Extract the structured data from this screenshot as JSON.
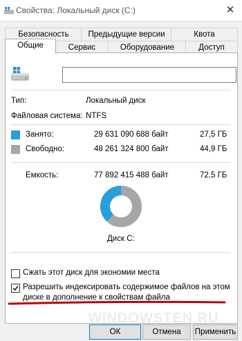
{
  "window": {
    "title": "Свойства: Локальный диск (C:)",
    "close_glyph": "✕"
  },
  "tabs_row1": [
    "Безопасность",
    "Предыдущие версии",
    "Квота"
  ],
  "tabs_row2": [
    "Общие",
    "Сервис",
    "Оборудование",
    "Доступ"
  ],
  "active_tab": "Общие",
  "general": {
    "name_value": "",
    "type_label": "Тип:",
    "type_value": "Локальный диск",
    "fs_label": "Файловая система:",
    "fs_value": "NTFS",
    "used": {
      "label": "Занято:",
      "bytes": "29 631 090 688 байт",
      "size": "27,5 ГБ",
      "color": "#26a0da"
    },
    "free": {
      "label": "Свободно:",
      "bytes": "48 261 324 800 байт",
      "size": "44,9 ГБ",
      "color": "#a6a6a6"
    },
    "capacity": {
      "label": "Емкость:",
      "bytes": "77 892 415 488 байт",
      "size": "72,5 ГБ"
    },
    "used_fraction": 0.38,
    "disk_label": "Диск C:",
    "compress_label": "Сжать этот диск для экономии места",
    "compress_checked": false,
    "index_label_line1": "Разрешить индексировать содержимое файлов на этом",
    "index_label_line2": "диске в дополнение к свойствам файла",
    "index_checked": true
  },
  "buttons": {
    "ok": "ОК",
    "cancel": "Отмена",
    "apply": "Применить"
  },
  "watermark": "WINDOWSTEN.RU",
  "colors": {
    "annotation_underline": "#c00000",
    "accent": "#0078d7"
  }
}
